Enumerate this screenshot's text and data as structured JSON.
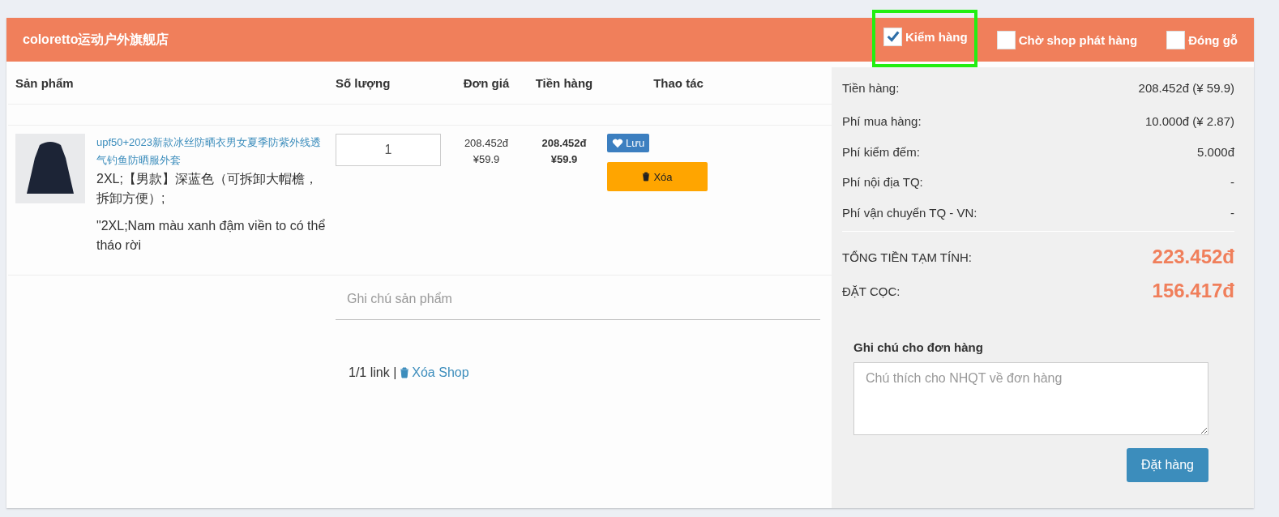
{
  "shop": {
    "name": "coloretto运动户外旗舰店"
  },
  "options": [
    {
      "label": "Kiểm hàng",
      "checked": true,
      "highlighted": true
    },
    {
      "label": "Chờ shop phát hàng",
      "checked": false,
      "highlighted": false
    },
    {
      "label": "Đóng gỗ",
      "checked": false,
      "highlighted": false
    }
  ],
  "table": {
    "columns": [
      "Sản phẩm",
      "Số lượng",
      "Đơn giá",
      "Tiền hàng",
      "Thao tác"
    ],
    "rows": [
      {
        "title": "upf50+2023新款冰丝防晒衣男女夏季防紫外线透气钓鱼防晒服外套",
        "variant": "2XL;【男款】深蓝色（可拆卸大帽檐，拆卸方便）;",
        "variant_vi": "\"2XL;Nam màu xanh đậm viền to có thể tháo rời",
        "quantity": "1",
        "unit_price_vnd": "208.452đ",
        "unit_price_cny": "¥59.9",
        "total_vnd": "208.452đ",
        "total_cny": "¥59.9",
        "save_label": "Lưu",
        "delete_label": "Xóa",
        "note_placeholder": "Ghi chú sản phẩm"
      }
    ]
  },
  "footer": {
    "count": "1/1 link |",
    "delete_shop": "Xóa Shop"
  },
  "summary": {
    "lines": [
      {
        "label": "Tiền hàng:",
        "value": "208.452đ (¥ 59.9)"
      },
      {
        "label": "Phí mua hàng:",
        "value": "10.000đ (¥ 2.87)"
      },
      {
        "label": "Phí kiểm đếm:",
        "value": "5.000đ"
      },
      {
        "label": "Phí nội địa TQ:",
        "value": "-"
      },
      {
        "label": "Phí vận chuyển TQ - VN:",
        "value": "-"
      }
    ],
    "totals": [
      {
        "label": "TỔNG TIỀN TẠM TÍNH:",
        "value": "223.452đ"
      },
      {
        "label": "ĐẶT CỌC:",
        "value": "156.417đ"
      }
    ],
    "note_label": "Ghi chú cho đơn hàng",
    "note_placeholder": "Chú thích cho NHQT về đơn hàng",
    "order_button": "Đặt hàng"
  }
}
